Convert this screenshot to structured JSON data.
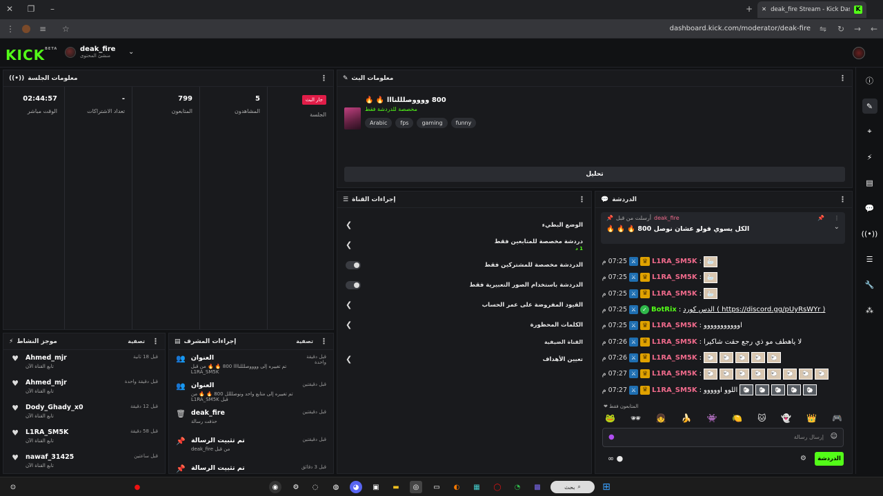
{
  "browser": {
    "tab_title": "deak_fire Stream - Kick Dashbo",
    "url": "dashboard.kick.com/moderator/deak-fire"
  },
  "header": {
    "logo": "KICK",
    "logo_beta": "BETA",
    "channel_name": "deak_fire",
    "channel_role": "منشئ المحتوى"
  },
  "session": {
    "title": "معلومات الجلسة",
    "live_label": "جار البث",
    "session_label": "الجلسة",
    "stats": [
      {
        "value": "5",
        "label": "المشاهدون"
      },
      {
        "value": "799",
        "label": "المتابعون"
      },
      {
        "value": "-",
        "label": "تعداد الاشتراكات"
      },
      {
        "value": "02:44:57",
        "label": "الوقت مباشر"
      }
    ]
  },
  "stream": {
    "title": "معلومات البث",
    "stream_title": "800 ووووصلللنااا 🔥 🔥",
    "category": "مخصصة للدردشة فقط",
    "tags": [
      "Arabic",
      "fps",
      "gaming",
      "funny"
    ],
    "edit_label": "تحليل"
  },
  "channel_actions": {
    "title": "إجراءات القناة",
    "rows": [
      {
        "label": "الوضع البطيء",
        "kind": "chevron"
      },
      {
        "label": "دردشة مخصصة للمتابعين فقط",
        "sub": "1 د",
        "kind": "chevron"
      },
      {
        "label": "الدردشة مخصصة للمشتركين فقط",
        "kind": "toggle"
      },
      {
        "label": "الدردشة باستخدام الصور التعبيرية فقط",
        "kind": "toggle"
      },
      {
        "label": "القيود المفروضة على عمر الحساب",
        "kind": "chevron"
      },
      {
        "label": "الكلمات المحظورة",
        "kind": "chevron"
      }
    ],
    "section": "القناة الضيفية",
    "goals": "تعيين الأهداف"
  },
  "chat": {
    "title": "الدردشة",
    "pinned_by_label": "أرسلت من قبل",
    "pinned_by": "deak_fire",
    "pinned_text": "الكل يسوي فولو عشان نوصل 800 🔥 🔥 🔥",
    "messages": [
      {
        "time": "07:25 م",
        "user": "L1RA_SM5K",
        "text": "",
        "emotes": 1,
        "bot": false
      },
      {
        "time": "07:25 م",
        "user": "L1RA_SM5K",
        "text": "",
        "emotes": 1,
        "bot": false
      },
      {
        "time": "07:25 م",
        "user": "L1RA_SM5K",
        "text": "",
        "emotes": 1,
        "bot": false
      },
      {
        "time": "07:25 م",
        "user": "BotRix",
        "text": "( https://discord.gg/pUyRsWYr ) الدس كورد",
        "emotes": 0,
        "bot": true
      },
      {
        "time": "07:25 م",
        "user": "L1RA_SM5K",
        "text": "اووووووووووو",
        "emotes": 0,
        "bot": false
      },
      {
        "time": "07:26 م",
        "user": "L1RA_SM5K",
        "text": "لا ياهطف مو ذي رجع حقت شاكيرا",
        "emotes": 0,
        "bot": false
      },
      {
        "time": "07:26 م",
        "user": "L1RA_SM5K",
        "text": "",
        "emotes": 5,
        "bot": false
      },
      {
        "time": "07:27 م",
        "user": "L1RA_SM5K",
        "text": "",
        "emotes": 8,
        "bot": false
      },
      {
        "time": "07:27 م",
        "user": "L1RA_SM5K",
        "text": "اللوو اووووو",
        "emotes": 5,
        "bot": false
      }
    ],
    "followers_only": "المتابعون فقط",
    "input_placeholder": "إرسال رسالة",
    "send_label": "الدردشة"
  },
  "mod_actions": {
    "title": "إجراءات المشرف",
    "clear": "تصفية",
    "items": [
      {
        "name": "العنوان",
        "sub": "تم تغييره إلى ووووصلللناااا 800 🔥 🔥 من قبل L1RA_SM5K",
        "time": "قبل دقيقة واحدة",
        "icon": "people"
      },
      {
        "name": "العنوان",
        "sub": "تم تغييره إلى متابع واحد ونوصلللل 800 🔥 🔥 من قبل L1RA_SM5K",
        "time": "قبل دقيقتين",
        "icon": "people"
      },
      {
        "name": "deak_fire",
        "sub": "حذفت رسالة",
        "time": "قبل دقيقتين",
        "icon": "trash"
      },
      {
        "name": "تم تثبيت الرسالة",
        "sub": "من قبل deak_fire",
        "time": "قبل دقيقتين",
        "icon": "pin"
      },
      {
        "name": "تم تثبيت الرسالة",
        "sub": "",
        "time": "قبل 3 دقائق",
        "icon": "pin"
      }
    ]
  },
  "activity": {
    "title": "موجز النشاط",
    "clear": "تصفية",
    "items": [
      {
        "name": "Ahmed_mjr",
        "sub": "تابع القناة الآن",
        "time": "قبل 18 ثانية"
      },
      {
        "name": "Ahmed_mjr",
        "sub": "تابع القناة الآن",
        "time": "قبل دقيقة واحدة"
      },
      {
        "name": "Dody_Ghady_x0",
        "sub": "تابع القناة الآن",
        "time": "قبل 12 دقيقة"
      },
      {
        "name": "L1RA_SM5K",
        "sub": "تابع القناة الآن",
        "time": "قبل 58 دقيقة"
      },
      {
        "name": "nawaf_31425",
        "sub": "تابع القناة الآن",
        "time": "قبل ساعتين"
      }
    ]
  },
  "taskbar": {
    "search": "بحث"
  },
  "colors": {
    "accent": "#53fc18",
    "live": "#e11d48",
    "username": "#ef6a8b"
  }
}
